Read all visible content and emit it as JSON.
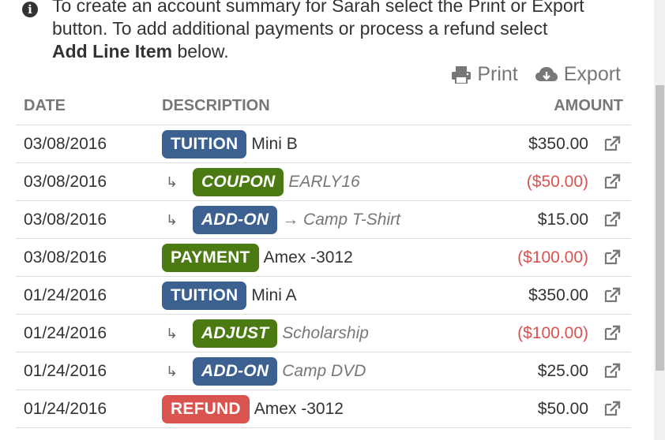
{
  "info": {
    "line1": "To create an account summary for Sarah select the Print or Export",
    "line2": "button. To add additional payments or process a refund select",
    "bold": "Add Line Item",
    "tail": " below."
  },
  "actions": {
    "print_label": "Print",
    "export_label": "Export"
  },
  "table": {
    "headers": {
      "date": "DATE",
      "description": "DESCRIPTION",
      "amount": "AMOUNT"
    },
    "rows": [
      {
        "date": "03/08/2016",
        "sub": false,
        "badge": "TUITION",
        "badge_color": "#3c6190",
        "detail": "Mini B",
        "italic": false,
        "amount": "$350.00",
        "negative": false
      },
      {
        "date": "03/08/2016",
        "sub": true,
        "badge": "COUPON",
        "badge_color": "#4b7a12",
        "detail": "EARLY16",
        "italic": true,
        "amount": "($50.00)",
        "negative": true
      },
      {
        "date": "03/08/2016",
        "sub": true,
        "badge": "ADD-ON",
        "badge_color": "#3c6190",
        "detail": "→ Camp T-Shirt",
        "italic": true,
        "amount": "$15.00",
        "negative": false
      },
      {
        "date": "03/08/2016",
        "sub": false,
        "badge": "PAYMENT",
        "badge_color": "#4b7a12",
        "detail": "Amex -3012",
        "italic": false,
        "amount": "($100.00)",
        "negative": true
      },
      {
        "date": "01/24/2016",
        "sub": false,
        "badge": "TUITION",
        "badge_color": "#3c6190",
        "detail": "Mini A",
        "italic": false,
        "amount": "$350.00",
        "negative": false
      },
      {
        "date": "01/24/2016",
        "sub": true,
        "badge": "ADJUST",
        "badge_color": "#4b7a12",
        "detail": "Scholarship",
        "italic": true,
        "amount": "($100.00)",
        "negative": true
      },
      {
        "date": "01/24/2016",
        "sub": true,
        "badge": "ADD-ON",
        "badge_color": "#3c6190",
        "detail": "Camp DVD",
        "italic": true,
        "amount": "$25.00",
        "negative": false
      },
      {
        "date": "01/24/2016",
        "sub": false,
        "badge": "REFUND",
        "badge_color": "#d9534f",
        "detail": "Amex -3012",
        "italic": false,
        "amount": "$50.00",
        "negative": false
      }
    ]
  },
  "colors": {
    "negative": "#d9534f",
    "muted": "#777777",
    "border": "#dddddd"
  },
  "icons": {
    "info": "info-icon",
    "print": "printer-icon",
    "export": "cloud-download-icon",
    "row_link": "external-link-icon",
    "sub_arrow": "sub-arrow-icon"
  }
}
